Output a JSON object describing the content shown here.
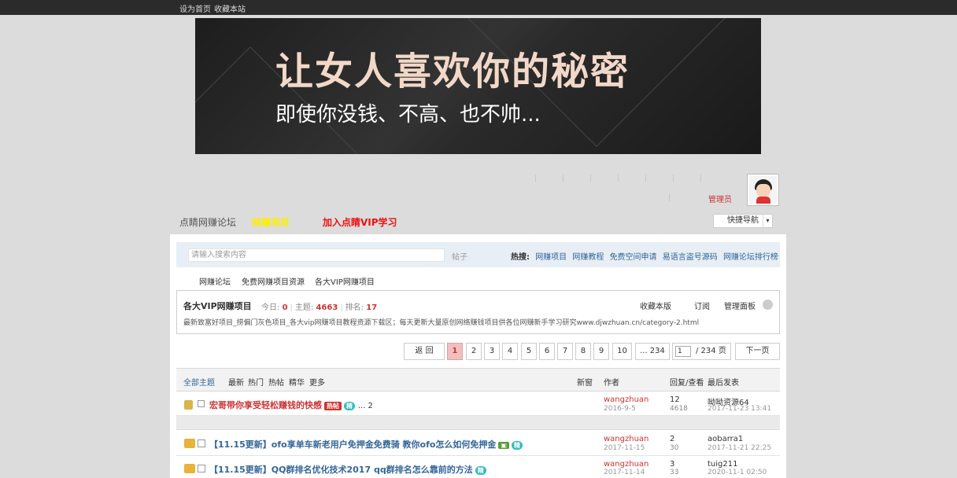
{
  "topbar": {
    "set_home": "设为首页",
    "bookmark": "收藏本站"
  },
  "banner": {
    "headline": "让女人喜欢你的秘密",
    "subline": "即使你没钱、不高、也不帅..."
  },
  "user": {
    "admin_label": "管理员"
  },
  "nav": {
    "forum": "点睛网赚论坛",
    "project": "网赚项目",
    "vip": "加入点睛VIP学习",
    "quick_nav": "快捷导航",
    "colors": {
      "project": "#ffee00",
      "vip": "#ee1111"
    }
  },
  "search": {
    "placeholder": "请输入搜索内容",
    "button": "帖子",
    "hot_label": "热搜:",
    "hot_terms": [
      "网赚项目",
      "网赚教程",
      "免费空间申请",
      "易语言盗号源码",
      "网赚论坛排行榜"
    ]
  },
  "breadcrumb": [
    "网赚论坛",
    "免费网赚项目资源",
    "各大VIP网赚项目"
  ],
  "forum": {
    "title": "各大VIP网赚项目",
    "today_label": "今日:",
    "today": "0",
    "topics_label": "主题:",
    "topics": "4663",
    "rank_label": "排名:",
    "rank": "17",
    "actions": [
      "收藏本版",
      "订阅",
      "管理面板"
    ],
    "description": "最新致富好项目_捞偏门灰色项目_各大vip网赚项目教程资源下载区；每天更新大量原创网络赚钱项目供各位网赚新手学习研究www.djwzhuan.cn/category-2.html"
  },
  "pager": {
    "back": "返 回",
    "pages": [
      "1",
      "2",
      "3",
      "4",
      "5",
      "6",
      "7",
      "8",
      "9",
      "10",
      "... 234"
    ],
    "current": "1",
    "total": "/ 234 页",
    "next": "下一页"
  },
  "table": {
    "filters": [
      "全部主题",
      "最新",
      "热门",
      "热帖",
      "精华",
      "更多"
    ],
    "new_window": "新窗",
    "author": "作者",
    "replies_views": "回复/查看",
    "last_post": "最后发表"
  },
  "threads": [
    {
      "title": "宏哥带你享受轻松赚钱的快感",
      "badges": [
        "热帖",
        "精"
      ],
      "pages": "... 2",
      "author": "wangzhuan",
      "date": "2016-9-5",
      "replies": "12",
      "views": "4618",
      "last_user": "呦呦资源64",
      "last_date": "2017-11-23 13:41"
    },
    {
      "title": "【11.15更新】ofo享单车新老用户免押金免费骑 教你ofo怎么如何免押金",
      "badges": [
        "精"
      ],
      "author": "wangzhuan",
      "date": "2017-11-15",
      "replies": "2",
      "views": "30",
      "last_user": "aobarra1",
      "last_date": "2017-11-21 22:25"
    },
    {
      "title": "【11.15更新】QQ群排名优化技术2017 qq群排名怎么靠前的方法",
      "badges": [
        "精"
      ],
      "author": "wangzhuan",
      "date": "2017-11-14",
      "replies": "3",
      "views": "33",
      "last_user": "tuig211",
      "last_date": "2020-11-1 02:50"
    }
  ]
}
